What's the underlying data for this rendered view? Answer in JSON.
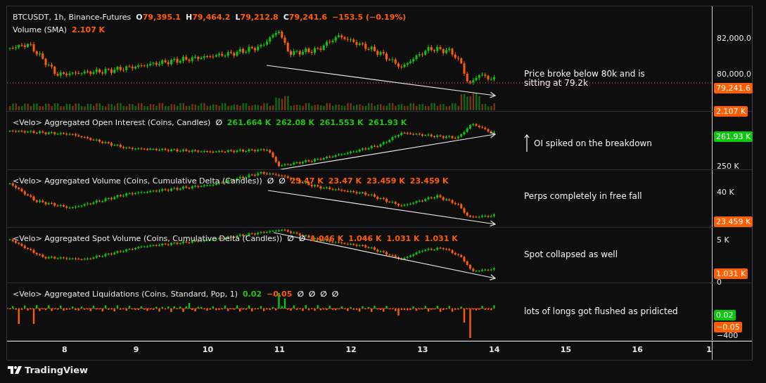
{
  "header": {
    "symbol": "BTCUSDT, 1h, Binance-Futures",
    "ohlc": [
      {
        "label": "O",
        "value": "79,395.1"
      },
      {
        "label": "H",
        "value": "79,464.2"
      },
      {
        "label": "L",
        "value": "79,212.8"
      },
      {
        "label": "C",
        "value": "79,241.6"
      }
    ],
    "change": "−153.5 (−0.19%)",
    "volume_name": "Volume (SMA)",
    "volume_value": "2.107 K"
  },
  "panes": [
    {
      "kind": "price",
      "annotation": "Price broke below 80k and is sitting at 79.2k",
      "axis": [
        "82,000.0",
        "80,000.0"
      ],
      "tags": [
        {
          "text": "79,241.6",
          "color": "#ff5d00"
        },
        {
          "text": "2.107 K",
          "color": "#ff5d00"
        }
      ]
    },
    {
      "kind": "open_interest",
      "title": "<Velo> Aggregated Open Interest (Coins, Candles)",
      "annotation": "OI spiked on the breakdown",
      "annotation_arrow": true,
      "values": [
        {
          "text": "∅",
          "color": "#ffffff"
        },
        {
          "text": "261.664 K",
          "color": "#22c40f"
        },
        {
          "text": "262.08 K",
          "color": "#22c40f"
        },
        {
          "text": "261.553 K",
          "color": "#22c40f"
        },
        {
          "text": "261.93 K",
          "color": "#22c40f"
        }
      ],
      "axis": [
        "250 K"
      ],
      "tags": [
        {
          "text": "261.93 K",
          "color": "#0bc70b"
        }
      ]
    },
    {
      "kind": "volume",
      "title": "<Velo> Aggregated Volume (Coins, Cumulative Delta (Candles))",
      "annotation": "Perps completely in free fall",
      "values": [
        {
          "text": "∅",
          "color": "#ffffff"
        },
        {
          "text": "∅",
          "color": "#ffffff"
        },
        {
          "text": "23.47 K",
          "color": "#ff5d00"
        },
        {
          "text": "23.47 K",
          "color": "#ff5d00"
        },
        {
          "text": "23.459 K",
          "color": "#ff5d00"
        },
        {
          "text": "23.459 K",
          "color": "#ff5d00"
        }
      ],
      "axis": [
        "40 K"
      ],
      "tags": [
        {
          "text": "23.459 K",
          "color": "#ff5d00"
        }
      ]
    },
    {
      "kind": "spot",
      "title": "<Velo> Aggregated Spot Volume (Coins, Cumulative Delta (Candles))",
      "annotation": "Spot collapsed as well",
      "values": [
        {
          "text": "∅",
          "color": "#ffffff"
        },
        {
          "text": "∅",
          "color": "#ffffff"
        },
        {
          "text": "1.046 K",
          "color": "#ff5d00"
        },
        {
          "text": "1.046 K",
          "color": "#ff5d00"
        },
        {
          "text": "1.031 K",
          "color": "#ff5d00"
        },
        {
          "text": "1.031 K",
          "color": "#ff5d00"
        }
      ],
      "axis": [
        "5 K",
        "0"
      ],
      "tags": [
        {
          "text": "1.031 K",
          "color": "#ff5d00"
        }
      ]
    },
    {
      "kind": "liquidations",
      "title": "<Velo> Aggregated Liquidations (Coins, Standard, Pop, 1)",
      "annotation": "lots of longs got flushed as pridicted",
      "values": [
        {
          "text": "0.02",
          "color": "#22c40f"
        },
        {
          "text": "−0.05",
          "color": "#ff5d00"
        },
        {
          "text": "∅",
          "color": "#ffffff"
        },
        {
          "text": "∅",
          "color": "#ffffff"
        },
        {
          "text": "∅",
          "color": "#ffffff"
        },
        {
          "text": "∅",
          "color": "#ffffff"
        }
      ],
      "axis": [
        "−400"
      ],
      "tags": [
        {
          "text": "0.02",
          "color": "#0bc70b"
        },
        {
          "text": "−0.05",
          "color": "#ff5d00"
        }
      ]
    }
  ],
  "time_axis": [
    "8",
    "9",
    "10",
    "11",
    "12",
    "13",
    "14",
    "15",
    "16",
    "1"
  ],
  "brand": "TradingView"
}
